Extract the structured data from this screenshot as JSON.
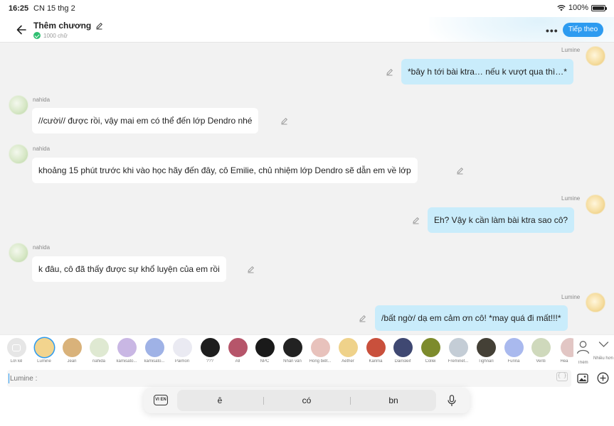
{
  "status_bar": {
    "time": "16:25",
    "date": "CN 15 thg 2",
    "battery": "100%"
  },
  "header": {
    "title": "Thêm chương",
    "word_count": "1000 chữ",
    "next_label": "Tiếp theo",
    "accent": "#2d9bf0"
  },
  "messages": [
    {
      "speaker": "Lumine",
      "side": "right",
      "text": "*bây h tới bài ktra… nếu k vượt qua thì…*"
    },
    {
      "speaker": "nahida",
      "side": "left",
      "text": "//cười// được rồi, vậy mai em có thể đến lớp Dendro nhé"
    },
    {
      "speaker": "nahida",
      "side": "left",
      "text": "khoảng 15 phút trước khi vào học hãy đến đây, cô Emilie, chủ nhiệm lớp Dendro sẽ dẫn em về lớp"
    },
    {
      "speaker": "Lumine",
      "side": "right",
      "text": "Eh? Vậy k cần làm bài ktra sao cô?"
    },
    {
      "speaker": "nahida",
      "side": "left",
      "text": "k đâu, cô đã thấy được sự khổ luyện của em rồi"
    },
    {
      "speaker": "Lumine",
      "side": "right",
      "text": "/bất ngờ/ dạ em cảm ơn cô! *may quá đi mất!!!*"
    }
  ],
  "characters": [
    {
      "label": "Lời kể",
      "color": "#e4e4e4"
    },
    {
      "label": "Lumine",
      "color": "#f2d48e",
      "selected": true
    },
    {
      "label": "Jean",
      "color": "#d9b27a"
    },
    {
      "label": "nahida",
      "color": "#dfe9d2"
    },
    {
      "label": "kamisato...",
      "color": "#c9b7e4"
    },
    {
      "label": "kamisato...",
      "color": "#9fb2e6"
    },
    {
      "label": "Paimon",
      "color": "#eaeaf2"
    },
    {
      "label": "???",
      "color": "#1e1e1e"
    },
    {
      "label": "All",
      "color": "#b6556a"
    },
    {
      "label": "NPC",
      "color": "#1a1a1a"
    },
    {
      "label": "Nhân vân",
      "color": "#222222"
    },
    {
      "label": "Hong biểt...",
      "color": "#e8c2bc"
    },
    {
      "label": "Aether",
      "color": "#efd28a"
    },
    {
      "label": "Karima",
      "color": "#c9503c"
    },
    {
      "label": "Dainsleif",
      "color": "#3f4872"
    },
    {
      "label": "Collei",
      "color": "#7d8b2c"
    },
    {
      "label": "Freminet...",
      "color": "#c4cdd6"
    },
    {
      "label": "Tighnari",
      "color": "#444036"
    },
    {
      "label": "Furina",
      "color": "#a9b9ee"
    },
    {
      "label": "Venti",
      "color": "#cfd9bc"
    },
    {
      "label": "Hea",
      "color": "#e2c6c4"
    },
    {
      "label": "Thêm",
      "color": "#ffffff"
    },
    {
      "label": "Nhiều hơn",
      "color": "#ffffff"
    }
  ],
  "input": {
    "placeholder": "Lumine :"
  },
  "keyboard": {
    "lang": "VI EN",
    "suggestions": [
      "ê",
      "có",
      "bn"
    ]
  }
}
